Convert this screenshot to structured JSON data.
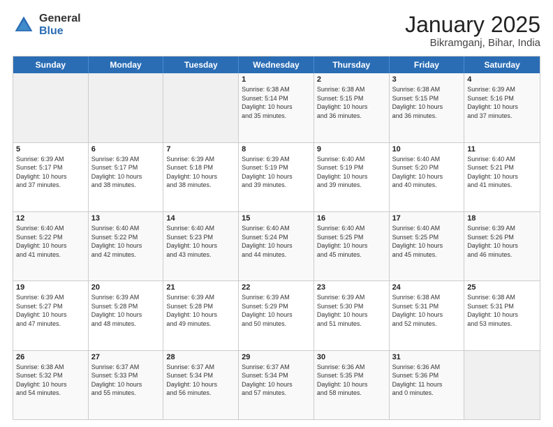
{
  "header": {
    "logo_general": "General",
    "logo_blue": "Blue",
    "month_title": "January 2025",
    "location": "Bikramganj, Bihar, India"
  },
  "weekdays": [
    "Sunday",
    "Monday",
    "Tuesday",
    "Wednesday",
    "Thursday",
    "Friday",
    "Saturday"
  ],
  "rows": [
    [
      {
        "day": "",
        "info": ""
      },
      {
        "day": "",
        "info": ""
      },
      {
        "day": "",
        "info": ""
      },
      {
        "day": "1",
        "info": "Sunrise: 6:38 AM\nSunset: 5:14 PM\nDaylight: 10 hours\nand 35 minutes."
      },
      {
        "day": "2",
        "info": "Sunrise: 6:38 AM\nSunset: 5:15 PM\nDaylight: 10 hours\nand 36 minutes."
      },
      {
        "day": "3",
        "info": "Sunrise: 6:38 AM\nSunset: 5:15 PM\nDaylight: 10 hours\nand 36 minutes."
      },
      {
        "day": "4",
        "info": "Sunrise: 6:39 AM\nSunset: 5:16 PM\nDaylight: 10 hours\nand 37 minutes."
      }
    ],
    [
      {
        "day": "5",
        "info": "Sunrise: 6:39 AM\nSunset: 5:17 PM\nDaylight: 10 hours\nand 37 minutes."
      },
      {
        "day": "6",
        "info": "Sunrise: 6:39 AM\nSunset: 5:17 PM\nDaylight: 10 hours\nand 38 minutes."
      },
      {
        "day": "7",
        "info": "Sunrise: 6:39 AM\nSunset: 5:18 PM\nDaylight: 10 hours\nand 38 minutes."
      },
      {
        "day": "8",
        "info": "Sunrise: 6:39 AM\nSunset: 5:19 PM\nDaylight: 10 hours\nand 39 minutes."
      },
      {
        "day": "9",
        "info": "Sunrise: 6:40 AM\nSunset: 5:19 PM\nDaylight: 10 hours\nand 39 minutes."
      },
      {
        "day": "10",
        "info": "Sunrise: 6:40 AM\nSunset: 5:20 PM\nDaylight: 10 hours\nand 40 minutes."
      },
      {
        "day": "11",
        "info": "Sunrise: 6:40 AM\nSunset: 5:21 PM\nDaylight: 10 hours\nand 41 minutes."
      }
    ],
    [
      {
        "day": "12",
        "info": "Sunrise: 6:40 AM\nSunset: 5:22 PM\nDaylight: 10 hours\nand 41 minutes."
      },
      {
        "day": "13",
        "info": "Sunrise: 6:40 AM\nSunset: 5:22 PM\nDaylight: 10 hours\nand 42 minutes."
      },
      {
        "day": "14",
        "info": "Sunrise: 6:40 AM\nSunset: 5:23 PM\nDaylight: 10 hours\nand 43 minutes."
      },
      {
        "day": "15",
        "info": "Sunrise: 6:40 AM\nSunset: 5:24 PM\nDaylight: 10 hours\nand 44 minutes."
      },
      {
        "day": "16",
        "info": "Sunrise: 6:40 AM\nSunset: 5:25 PM\nDaylight: 10 hours\nand 45 minutes."
      },
      {
        "day": "17",
        "info": "Sunrise: 6:40 AM\nSunset: 5:25 PM\nDaylight: 10 hours\nand 45 minutes."
      },
      {
        "day": "18",
        "info": "Sunrise: 6:39 AM\nSunset: 5:26 PM\nDaylight: 10 hours\nand 46 minutes."
      }
    ],
    [
      {
        "day": "19",
        "info": "Sunrise: 6:39 AM\nSunset: 5:27 PM\nDaylight: 10 hours\nand 47 minutes."
      },
      {
        "day": "20",
        "info": "Sunrise: 6:39 AM\nSunset: 5:28 PM\nDaylight: 10 hours\nand 48 minutes."
      },
      {
        "day": "21",
        "info": "Sunrise: 6:39 AM\nSunset: 5:28 PM\nDaylight: 10 hours\nand 49 minutes."
      },
      {
        "day": "22",
        "info": "Sunrise: 6:39 AM\nSunset: 5:29 PM\nDaylight: 10 hours\nand 50 minutes."
      },
      {
        "day": "23",
        "info": "Sunrise: 6:39 AM\nSunset: 5:30 PM\nDaylight: 10 hours\nand 51 minutes."
      },
      {
        "day": "24",
        "info": "Sunrise: 6:38 AM\nSunset: 5:31 PM\nDaylight: 10 hours\nand 52 minutes."
      },
      {
        "day": "25",
        "info": "Sunrise: 6:38 AM\nSunset: 5:31 PM\nDaylight: 10 hours\nand 53 minutes."
      }
    ],
    [
      {
        "day": "26",
        "info": "Sunrise: 6:38 AM\nSunset: 5:32 PM\nDaylight: 10 hours\nand 54 minutes."
      },
      {
        "day": "27",
        "info": "Sunrise: 6:37 AM\nSunset: 5:33 PM\nDaylight: 10 hours\nand 55 minutes."
      },
      {
        "day": "28",
        "info": "Sunrise: 6:37 AM\nSunset: 5:34 PM\nDaylight: 10 hours\nand 56 minutes."
      },
      {
        "day": "29",
        "info": "Sunrise: 6:37 AM\nSunset: 5:34 PM\nDaylight: 10 hours\nand 57 minutes."
      },
      {
        "day": "30",
        "info": "Sunrise: 6:36 AM\nSunset: 5:35 PM\nDaylight: 10 hours\nand 58 minutes."
      },
      {
        "day": "31",
        "info": "Sunrise: 6:36 AM\nSunset: 5:36 PM\nDaylight: 11 hours\nand 0 minutes."
      },
      {
        "day": "",
        "info": ""
      }
    ]
  ]
}
